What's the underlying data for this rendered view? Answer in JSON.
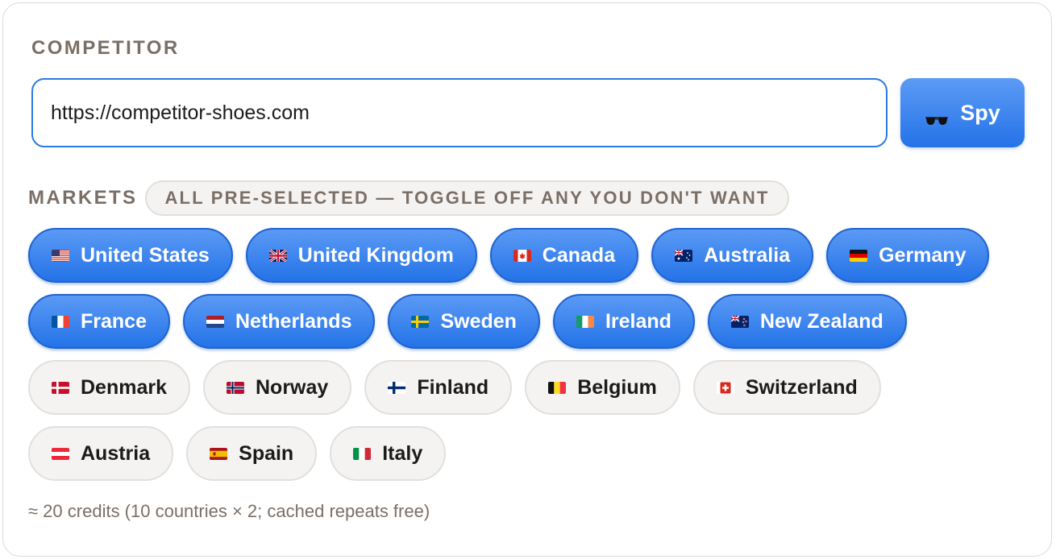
{
  "competitor": {
    "label": "COMPETITOR",
    "url_value": "https://competitor-shoes.com",
    "spy_button_label": "Spy",
    "spy_icon": "sunglasses-icon"
  },
  "markets": {
    "label": "MARKETS",
    "hint": "ALL PRE-SELECTED — TOGGLE OFF ANY YOU DON'T WANT",
    "countries": [
      {
        "name": "United States",
        "code": "us",
        "selected": true
      },
      {
        "name": "United Kingdom",
        "code": "gb",
        "selected": true
      },
      {
        "name": "Canada",
        "code": "ca",
        "selected": true
      },
      {
        "name": "Australia",
        "code": "au",
        "selected": true
      },
      {
        "name": "Germany",
        "code": "de",
        "selected": true
      },
      {
        "name": "France",
        "code": "fr",
        "selected": true
      },
      {
        "name": "Netherlands",
        "code": "nl",
        "selected": true
      },
      {
        "name": "Sweden",
        "code": "se",
        "selected": true
      },
      {
        "name": "Ireland",
        "code": "ie",
        "selected": true
      },
      {
        "name": "New Zealand",
        "code": "nz",
        "selected": true
      },
      {
        "name": "Denmark",
        "code": "dk",
        "selected": false
      },
      {
        "name": "Norway",
        "code": "no",
        "selected": false
      },
      {
        "name": "Finland",
        "code": "fi",
        "selected": false
      },
      {
        "name": "Belgium",
        "code": "be",
        "selected": false
      },
      {
        "name": "Switzerland",
        "code": "ch",
        "selected": false
      },
      {
        "name": "Austria",
        "code": "at",
        "selected": false
      },
      {
        "name": "Spain",
        "code": "es",
        "selected": false
      },
      {
        "name": "Italy",
        "code": "it",
        "selected": false
      }
    ]
  },
  "credits_note": "≈ 20 credits (10 countries × 2; cached repeats free)",
  "colors": {
    "accent": "#2a7be4",
    "chip_selected": "#3b86ee",
    "chip_unselected": "#f4f3f2",
    "label_text": "#7a6f66"
  }
}
